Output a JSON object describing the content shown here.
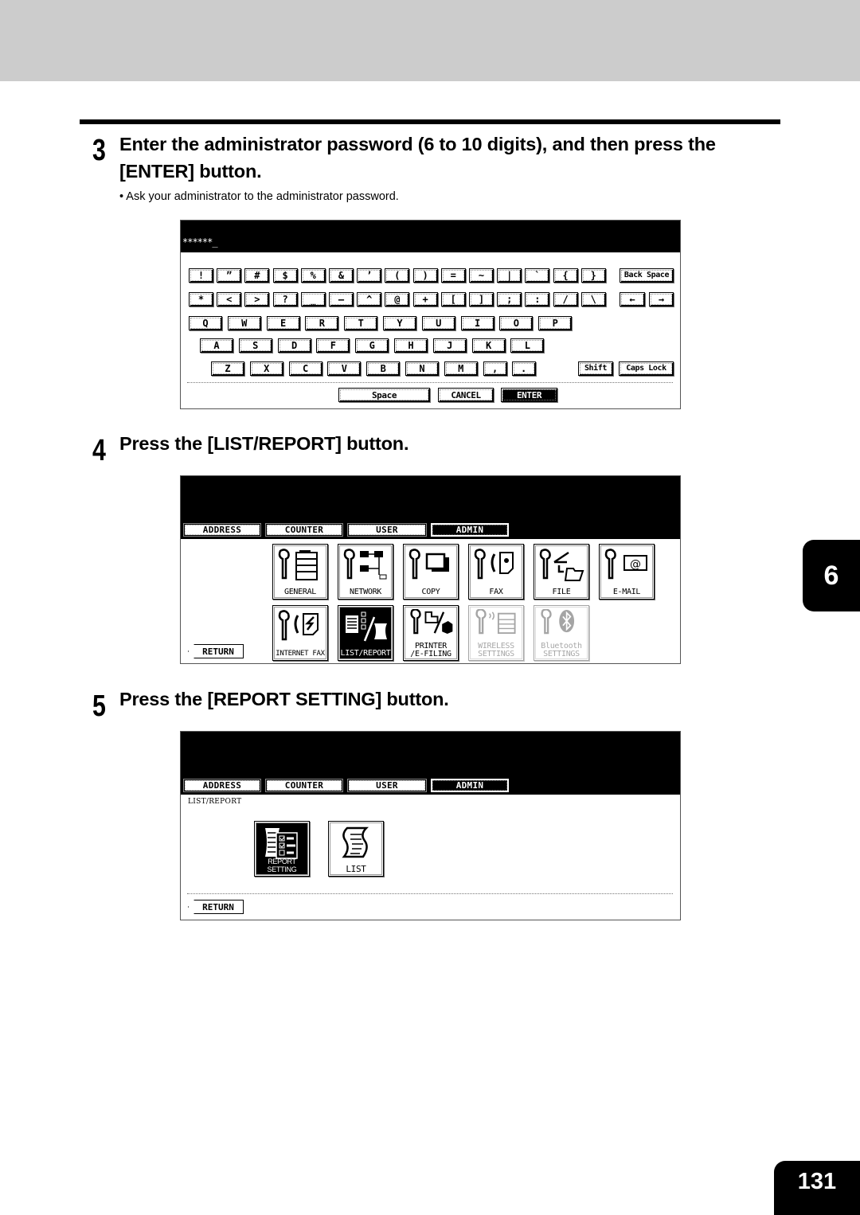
{
  "page": {
    "chapter": "6",
    "page_number": "131"
  },
  "step3": {
    "number": "3",
    "title_line1": "Enter the administrator password (6 to 10 digits), and then press the",
    "title_line2": "[ENTER] button.",
    "bullet": "•  Ask your administrator to the administrator password.",
    "keyboard": {
      "password_value": "******_",
      "row1": [
        "!",
        "”",
        "#",
        "$",
        "%",
        "&",
        "’",
        "(",
        ")",
        "=",
        "~",
        "|",
        "`",
        "{",
        "}"
      ],
      "row2": [
        "*",
        "<",
        ">",
        "?",
        "_",
        "—",
        "^",
        "@",
        "+",
        "[",
        "]",
        ";",
        ":",
        "/",
        "\\"
      ],
      "row3": [
        "Q",
        "W",
        "E",
        "R",
        "T",
        "Y",
        "U",
        "I",
        "O",
        "P"
      ],
      "row4": [
        "A",
        "S",
        "D",
        "F",
        "G",
        "H",
        "J",
        "K",
        "L"
      ],
      "row5": [
        "Z",
        "X",
        "C",
        "V",
        "B",
        "N",
        "M",
        ",",
        "."
      ],
      "backspace_label": "Back Space",
      "arrow_left": "←",
      "arrow_right": "→",
      "shift_label": "Shift",
      "caps_lock_label": "Caps Lock",
      "space_label": "Space",
      "cancel_label": "CANCEL",
      "enter_label": "ENTER"
    }
  },
  "step4": {
    "number": "4",
    "title": "Press the [LIST/REPORT] button.",
    "tabs": [
      {
        "label": "ADDRESS",
        "active": false
      },
      {
        "label": "COUNTER",
        "active": false
      },
      {
        "label": "USER",
        "active": false
      },
      {
        "label": "ADMIN",
        "active": true
      }
    ],
    "icons_row1": [
      {
        "label": "GENERAL",
        "icon": "general-icon"
      },
      {
        "label": "NETWORK",
        "icon": "network-icon"
      },
      {
        "label": "COPY",
        "icon": "copy-icon"
      },
      {
        "label": "FAX",
        "icon": "fax-icon"
      },
      {
        "label": "FILE",
        "icon": "file-icon"
      },
      {
        "label": "E-MAIL",
        "icon": "email-icon"
      }
    ],
    "icons_row2": [
      {
        "label": "INTERNET FAX",
        "icon": "internet-fax-icon",
        "state": "normal"
      },
      {
        "label": "LIST/REPORT",
        "icon": "list-report-icon",
        "state": "active"
      },
      {
        "label_line1": "PRINTER",
        "label_line2": "/E-FILING",
        "icon": "printer-efiling-icon",
        "state": "normal"
      },
      {
        "label_line1": "WIRELESS",
        "label_line2": "SETTINGS",
        "icon": "wireless-icon",
        "state": "disabled"
      },
      {
        "label_line1": "Bluetooth",
        "label_line2": "SETTINGS",
        "icon": "bluetooth-icon",
        "state": "disabled"
      }
    ],
    "return_label": "RETURN"
  },
  "step5": {
    "number": "5",
    "title": "Press the [REPORT SETTING] button.",
    "tabs": [
      {
        "label": "ADDRESS",
        "active": false
      },
      {
        "label": "COUNTER",
        "active": false
      },
      {
        "label": "USER",
        "active": false
      },
      {
        "label": "ADMIN",
        "active": true
      }
    ],
    "breadcrumb": "LIST/REPORT",
    "icons": [
      {
        "label": "REPORT SETTING",
        "icon": "report-setting-icon",
        "state": "active"
      },
      {
        "label": "LIST",
        "icon": "list-icon",
        "state": "normal"
      }
    ],
    "return_label": "RETURN"
  }
}
